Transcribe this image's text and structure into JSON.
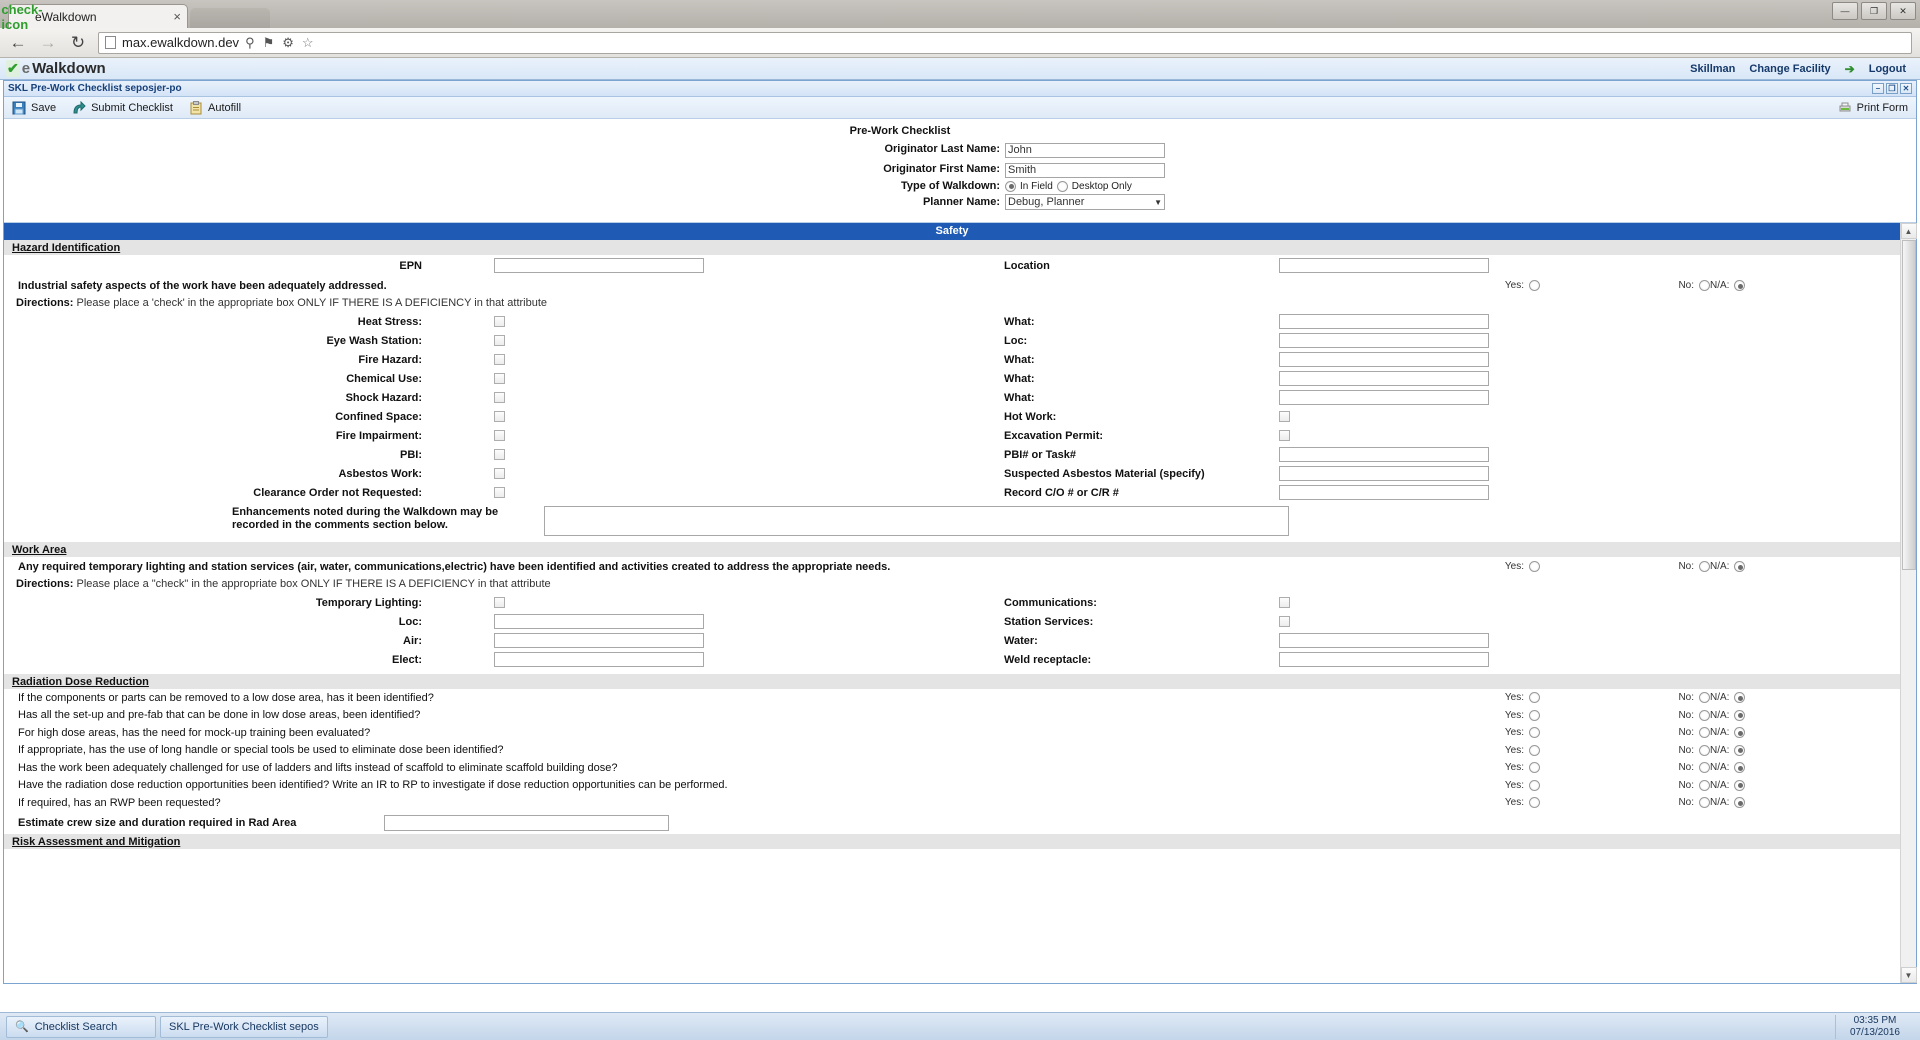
{
  "browser": {
    "tab_title": "eWalkdown",
    "tab_favicon": "check-icon",
    "tab_close": "×",
    "back_icon": "←",
    "forward_icon": "→",
    "reload_icon": "↻",
    "url": "max.ewalkdown.dev",
    "search_icon": "⚲",
    "flag_icon": "⚑",
    "wrench_icon": "⚙",
    "star_icon": "☆",
    "minimize": "—",
    "maximize": "❐",
    "close": "✕"
  },
  "app": {
    "brand_check": "✔",
    "brand_e": "e",
    "brand_name": "Walkdown",
    "facility": "Skillman",
    "change_facility": "Change Facility",
    "logout": "Logout",
    "logout_icon": "door-exit-icon"
  },
  "mdi": {
    "title": "SKL Pre-Work Checklist seposjer-po",
    "minimize": "–",
    "restore": "❐",
    "close": "✕"
  },
  "toolbar": {
    "save_label": "Save",
    "save_icon": "floppy-disk-icon",
    "submit_label": "Submit Checklist",
    "submit_icon": "arrow-submit-icon",
    "autofill_label": "Autofill",
    "autofill_icon": "clipboard-icon",
    "print_label": "Print Form",
    "print_icon": "printer-icon"
  },
  "form_header": {
    "title": "Pre-Work Checklist",
    "originator_last_label": "Originator Last Name:",
    "originator_last_value": "John",
    "originator_first_label": "Originator First Name:",
    "originator_first_value": "Smith",
    "type_label": "Type of Walkdown:",
    "type_options": [
      "In Field",
      "Desktop Only"
    ],
    "type_selected": "In Field",
    "planner_label": "Planner Name:",
    "planner_value": "Debug, Planner",
    "select_arrow": "▼"
  },
  "safety_banner": "Safety",
  "hazard": {
    "section_title": "Hazard Identification",
    "epn_label": "EPN",
    "epn_value": "",
    "location_label": "Location",
    "location_value": "",
    "statement": "Industrial safety aspects of the work have been adequately addressed.",
    "directions_bold": "Directions:",
    "directions_text": "Please place a 'check' in the appropriate box ONLY IF THERE IS A DEFICIENCY in that attribute",
    "yes_label": "Yes:",
    "no_label": "No:",
    "na_label": "N/A:",
    "answer": "N/A",
    "rows": [
      {
        "left_label": "Heat Stress:",
        "left_type": "checkbox",
        "left_checked": false,
        "right_label": "What:",
        "right_type": "text",
        "right_value": ""
      },
      {
        "left_label": "Eye Wash Station:",
        "left_type": "checkbox",
        "left_checked": false,
        "right_label": "Loc:",
        "right_type": "text",
        "right_value": ""
      },
      {
        "left_label": "Fire Hazard:",
        "left_type": "checkbox",
        "left_checked": false,
        "right_label": "What:",
        "right_type": "text",
        "right_value": ""
      },
      {
        "left_label": "Chemical Use:",
        "left_type": "checkbox",
        "left_checked": false,
        "right_label": "What:",
        "right_type": "text",
        "right_value": ""
      },
      {
        "left_label": "Shock Hazard:",
        "left_type": "checkbox",
        "left_checked": false,
        "right_label": "What:",
        "right_type": "text",
        "right_value": ""
      },
      {
        "left_label": "Confined Space:",
        "left_type": "checkbox",
        "left_checked": false,
        "right_label": "Hot Work:",
        "right_type": "checkbox",
        "right_checked": false
      },
      {
        "left_label": "Fire Impairment:",
        "left_type": "checkbox",
        "left_checked": false,
        "right_label": "Excavation Permit:",
        "right_type": "checkbox",
        "right_checked": false
      },
      {
        "left_label": "PBI:",
        "left_type": "checkbox",
        "left_checked": false,
        "right_label": "PBI# or Task#",
        "right_type": "text",
        "right_value": ""
      },
      {
        "left_label": "Asbestos Work:",
        "left_type": "checkbox",
        "left_checked": false,
        "right_label": "Suspected Asbestos Material (specify)",
        "right_type": "text",
        "right_value": ""
      },
      {
        "left_label": "Clearance Order not Requested:",
        "left_type": "checkbox",
        "left_checked": false,
        "right_label": "Record C/O # or C/R #",
        "right_type": "text",
        "right_value": ""
      }
    ],
    "enhancements_label": "Enhancements noted during the Walkdown may be recorded in the comments section below.",
    "enhancements_value": ""
  },
  "work_area": {
    "section_title": "Work Area",
    "statement": "Any required temporary lighting and station services (air, water, communications,electric) have been identified and activities created to address the appropriate needs.",
    "directions_bold": "Directions:",
    "directions_text": "Please place a \"check\" in the appropriate box ONLY IF THERE IS A DEFICIENCY in that attribute",
    "yes_label": "Yes:",
    "no_label": "No:",
    "na_label": "N/A:",
    "answer": "N/A",
    "rows": [
      {
        "left_label": "Temporary Lighting:",
        "left_type": "checkbox",
        "left_checked": false,
        "right_label": "Communications:",
        "right_type": "checkbox",
        "right_checked": false
      },
      {
        "left_label": "Loc:",
        "left_type": "text",
        "left_value": "",
        "right_label": "Station Services:",
        "right_type": "checkbox",
        "right_checked": false
      },
      {
        "left_label": "Air:",
        "left_type": "text",
        "left_value": "",
        "right_label": "Water:",
        "right_type": "text",
        "right_value": ""
      },
      {
        "left_label": "Elect:",
        "left_type": "text",
        "left_value": "",
        "right_label": "Weld receptacle:",
        "right_type": "text",
        "right_value": ""
      }
    ]
  },
  "radiation": {
    "section_title": "Radiation Dose Reduction",
    "yes_label": "Yes:",
    "no_label": "No:",
    "na_label": "N/A:",
    "questions": [
      {
        "text": "If the components or parts can be removed to a low dose area, has it been identified?",
        "answer": "N/A"
      },
      {
        "text": "Has all the set-up and pre-fab that can be done in low dose areas, been identified?",
        "answer": "N/A"
      },
      {
        "text": "For high dose areas, has the need for mock-up training been evaluated?",
        "answer": "N/A"
      },
      {
        "text": "If appropriate, has the use of long handle or special tools be used to eliminate dose been identified?",
        "answer": "N/A"
      },
      {
        "text": "Has the work been adequately challenged for use of ladders and lifts instead of scaffold to eliminate scaffold building dose?",
        "answer": "N/A"
      },
      {
        "text": "Have the radiation dose reduction opportunities been identified? Write an IR to RP to investigate if dose reduction opportunities can be performed.",
        "answer": "N/A"
      },
      {
        "text": "If required, has an RWP been requested?",
        "answer": "N/A"
      }
    ],
    "estimate_label": "Estimate crew size and duration required in Rad Area",
    "estimate_value": ""
  },
  "risk": {
    "section_title": "Risk Assessment and Mitigation"
  },
  "taskbar": {
    "items": [
      {
        "label": "Checklist Search",
        "icon": "magnifier-icon"
      },
      {
        "label": "SKL Pre-Work Checklist sepos",
        "icon": ""
      }
    ],
    "time": "03:35 PM",
    "date": "07/13/2016"
  },
  "colors": {
    "banner_blue": "#1f5bb5",
    "header_blue": "#15396b",
    "subsection_gray": "#e4e4e4"
  }
}
